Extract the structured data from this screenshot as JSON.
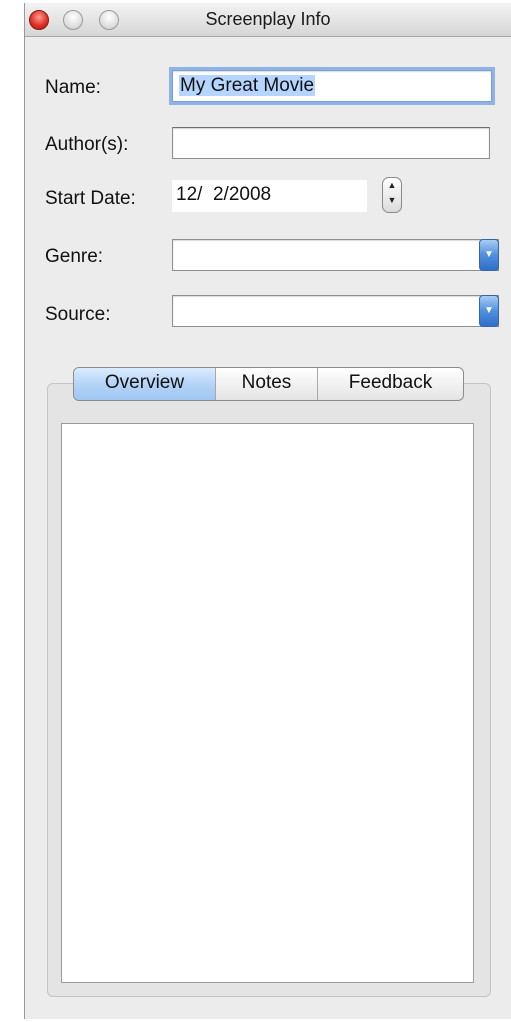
{
  "window": {
    "title": "Screenplay Info"
  },
  "form": {
    "name": {
      "label": "Name:",
      "value": "My Great Movie"
    },
    "authors": {
      "label": "Author(s):",
      "value": ""
    },
    "start_date": {
      "label": "Start Date:",
      "value": "12/  2/2008"
    },
    "genre": {
      "label": "Genre:",
      "value": ""
    },
    "source": {
      "label": "Source:",
      "value": ""
    }
  },
  "tabs": [
    {
      "label": "Overview",
      "active": true
    },
    {
      "label": "Notes",
      "active": false
    },
    {
      "label": "Feedback",
      "active": false
    }
  ],
  "icons": {
    "stepper_up": "▲",
    "stepper_down": "▼",
    "popup_arrow": "▼"
  },
  "colors": {
    "accent": "#4f8fde",
    "close_button": "#e2322a",
    "selection": "#b5d5ff"
  }
}
